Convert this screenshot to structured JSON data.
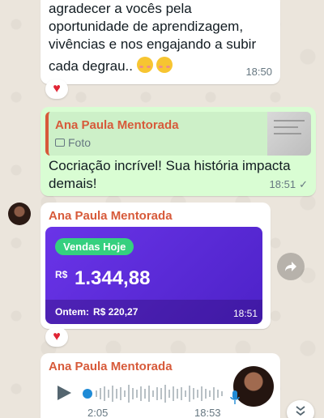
{
  "messages": [
    {
      "text": "agradecer a vocês pela oportunidade de aprendizagem, vivências e nos engajando a subir cada degrau..",
      "time": "18:50",
      "reaction": "♥"
    },
    {
      "quote_sender": "Ana Paula Mentorada",
      "quote_type": "Foto",
      "text": "Cocriação incrível! Sua história impacta demais!",
      "time": "18:51",
      "status": "✓"
    },
    {
      "sender": "Ana Paula Mentorada",
      "card": {
        "badge": "Vendas Hoje",
        "currency": "R$",
        "amount": "1.344,88",
        "yesterday_label": "Ontem:",
        "yesterday_value": "R$ 220,27"
      },
      "time": "18:51",
      "reaction": "♥"
    },
    {
      "sender": "Ana Paula Mentorada",
      "duration": "2:05",
      "time": "18:53"
    }
  ],
  "colors": {
    "sender": "#d75a3a",
    "card_bg": "#5b2bd9",
    "badge_bg": "#35d07f",
    "outgoing": "#d9fdd3"
  },
  "icons": {
    "play": "play-icon",
    "mic": "microphone-icon",
    "forward": "forward-icon",
    "scroll_down": "chevron-double-down-icon",
    "photo": "photo-icon"
  }
}
